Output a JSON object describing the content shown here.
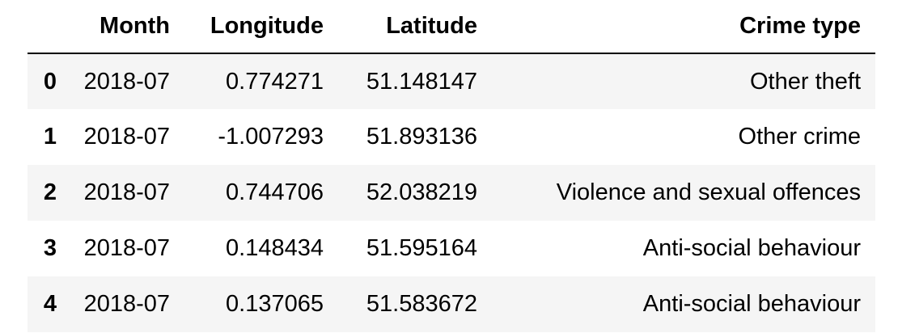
{
  "table": {
    "columns": [
      "",
      "Month",
      "Longitude",
      "Latitude",
      "Crime type"
    ],
    "rows": [
      {
        "index": "0",
        "month": "2018-07",
        "longitude": "0.774271",
        "latitude": "51.148147",
        "crime_type": "Other theft"
      },
      {
        "index": "1",
        "month": "2018-07",
        "longitude": "-1.007293",
        "latitude": "51.893136",
        "crime_type": "Other crime"
      },
      {
        "index": "2",
        "month": "2018-07",
        "longitude": "0.744706",
        "latitude": "52.038219",
        "crime_type": "Violence and sexual offences"
      },
      {
        "index": "3",
        "month": "2018-07",
        "longitude": "0.148434",
        "latitude": "51.595164",
        "crime_type": "Anti-social behaviour"
      },
      {
        "index": "4",
        "month": "2018-07",
        "longitude": "0.137065",
        "latitude": "51.583672",
        "crime_type": "Anti-social behaviour"
      }
    ]
  },
  "colors": {
    "stripe": "#f5f5f5",
    "header_rule": "#000000",
    "text": "#000000"
  }
}
